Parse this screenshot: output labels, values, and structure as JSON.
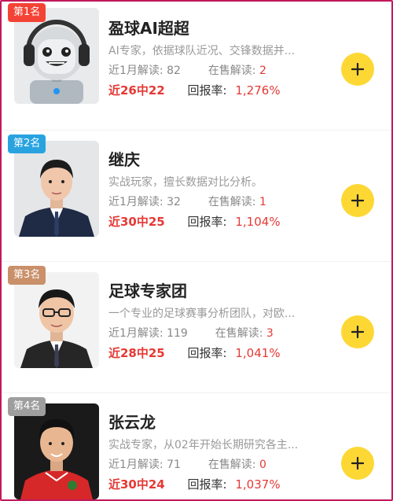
{
  "colors": {
    "rank1": "#f44336",
    "rank2": "#29a3e0",
    "rank3": "#c9906a",
    "rank4": "#9e9e9e",
    "accent": "#e53935",
    "follow": "#fdd835"
  },
  "labels": {
    "monthly": "近1月解读:",
    "on_sale": "在售解读:",
    "roi": "回报率:"
  },
  "experts": [
    {
      "rank": "第1名",
      "name": "盈球AI超超",
      "desc": "AI专家，依据球队近况、交锋数据并...",
      "monthly": "82",
      "on_sale": "2",
      "record": "近26中22",
      "roi": "1,276%"
    },
    {
      "rank": "第2名",
      "name": "继庆",
      "desc": "实战玩家，擅长数据对比分析。",
      "monthly": "32",
      "on_sale": "1",
      "record": "近30中25",
      "roi": "1,104%"
    },
    {
      "rank": "第3名",
      "name": "足球专家团",
      "desc": "一个专业的足球赛事分析团队，对欧...",
      "monthly": "119",
      "on_sale": "3",
      "record": "近28中25",
      "roi": "1,041%"
    },
    {
      "rank": "第4名",
      "name": "张云龙",
      "desc": "实战专家，从02年开始长期研究各主...",
      "monthly": "71",
      "on_sale": "0",
      "record": "近30中24",
      "roi": "1,037%"
    }
  ]
}
